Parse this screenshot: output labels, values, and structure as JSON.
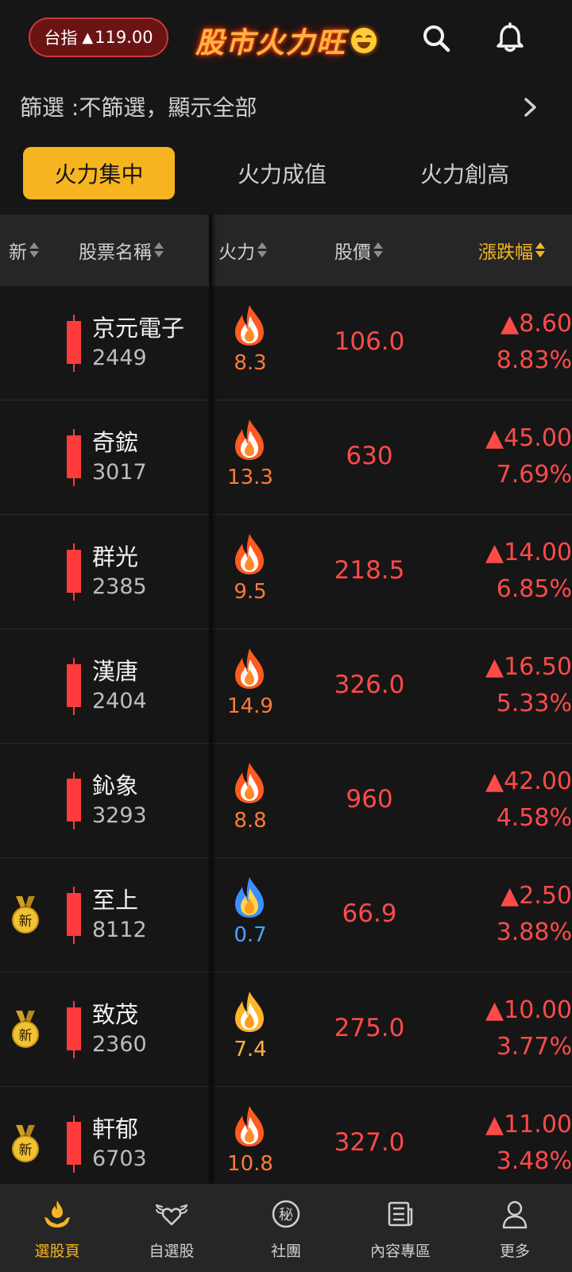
{
  "header": {
    "index_label": "台指",
    "index_arrow": "▲",
    "index_value": "119.00",
    "brand": "股市火力旺"
  },
  "filter": {
    "label": "篩選 :不篩選，顯示全部"
  },
  "tabs": [
    {
      "label": "火力集中",
      "active": true
    },
    {
      "label": "火力成值",
      "active": false
    },
    {
      "label": "火力創高",
      "active": false
    }
  ],
  "columns": {
    "new": "新",
    "name": "股票名稱",
    "fire": "火力",
    "price": "股價",
    "change": "漲跌幅"
  },
  "rows": [
    {
      "name": "京元電子",
      "code": "2449",
      "fire": "8.3",
      "fire_type": "red",
      "price": "106.0",
      "change": "▲8.60",
      "pct": "8.83%",
      "is_new": false
    },
    {
      "name": "奇鋐",
      "code": "3017",
      "fire": "13.3",
      "fire_type": "red",
      "price": "630",
      "change": "▲45.00",
      "pct": "7.69%",
      "is_new": false
    },
    {
      "name": "群光",
      "code": "2385",
      "fire": "9.5",
      "fire_type": "red",
      "price": "218.5",
      "change": "▲14.00",
      "pct": "6.85%",
      "is_new": false
    },
    {
      "name": "漢唐",
      "code": "2404",
      "fire": "14.9",
      "fire_type": "red",
      "price": "326.0",
      "change": "▲16.50",
      "pct": "5.33%",
      "is_new": false
    },
    {
      "name": "鈊象",
      "code": "3293",
      "fire": "8.8",
      "fire_type": "red",
      "price": "960",
      "change": "▲42.00",
      "pct": "4.58%",
      "is_new": false
    },
    {
      "name": "至上",
      "code": "8112",
      "fire": "0.7",
      "fire_type": "blue",
      "price": "66.9",
      "change": "▲2.50",
      "pct": "3.88%",
      "is_new": true,
      "medal_text": "新"
    },
    {
      "name": "致茂",
      "code": "2360",
      "fire": "7.4",
      "fire_type": "orange",
      "price": "275.0",
      "change": "▲10.00",
      "pct": "3.77%",
      "is_new": true,
      "medal_text": "新"
    },
    {
      "name": "軒郁",
      "code": "6703",
      "fire": "10.8",
      "fire_type": "red",
      "price": "327.0",
      "change": "▲11.00",
      "pct": "3.48%",
      "is_new": true,
      "medal_text": "新"
    }
  ],
  "nav": [
    {
      "label": "選股頁",
      "icon": "fire-hand-icon",
      "active": true
    },
    {
      "label": "自選股",
      "icon": "winged-heart-icon",
      "active": false
    },
    {
      "label": "社團",
      "icon": "secret-circle-icon",
      "icon_text": "秘",
      "active": false
    },
    {
      "label": "內容專區",
      "icon": "newspaper-icon",
      "active": false
    },
    {
      "label": "更多",
      "icon": "person-icon",
      "active": false
    }
  ],
  "colors": {
    "accent": "#f6b520",
    "up_red": "#ff4a4a",
    "fire_red_value": "#ff7a3a",
    "fire_blue_value": "#4aa3ff",
    "fire_orange_value": "#ffb347"
  }
}
